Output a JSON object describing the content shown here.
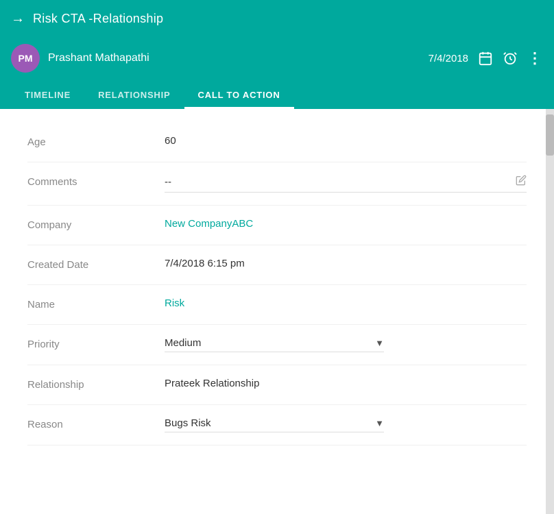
{
  "header": {
    "back_icon": "→",
    "title": "Risk CTA -Relationship"
  },
  "user_bar": {
    "avatar_initials": "PM",
    "user_name": "Prashant Mathapathi",
    "date": "7/4/2018",
    "calendar_icon": "📅",
    "alarm_icon": "⏰",
    "more_icon": "⋮"
  },
  "tabs": [
    {
      "label": "TIMELINE",
      "active": false
    },
    {
      "label": "RELATIONSHIP",
      "active": false
    },
    {
      "label": "CALL TO ACTION",
      "active": true
    }
  ],
  "fields": [
    {
      "label": "Age",
      "value": "60",
      "type": "text"
    },
    {
      "label": "Comments",
      "value": "--",
      "type": "editable"
    },
    {
      "label": "Company",
      "value": "New CompanyABC",
      "type": "link"
    },
    {
      "label": "Created Date",
      "value": "7/4/2018 6:15 pm",
      "type": "text"
    },
    {
      "label": "Name",
      "value": "Risk",
      "type": "link"
    },
    {
      "label": "Priority",
      "value": "Medium",
      "type": "dropdown"
    },
    {
      "label": "Relationship",
      "value": "Prateek Relationship",
      "type": "text"
    },
    {
      "label": "Reason",
      "value": "Bugs Risk",
      "type": "dropdown"
    }
  ]
}
